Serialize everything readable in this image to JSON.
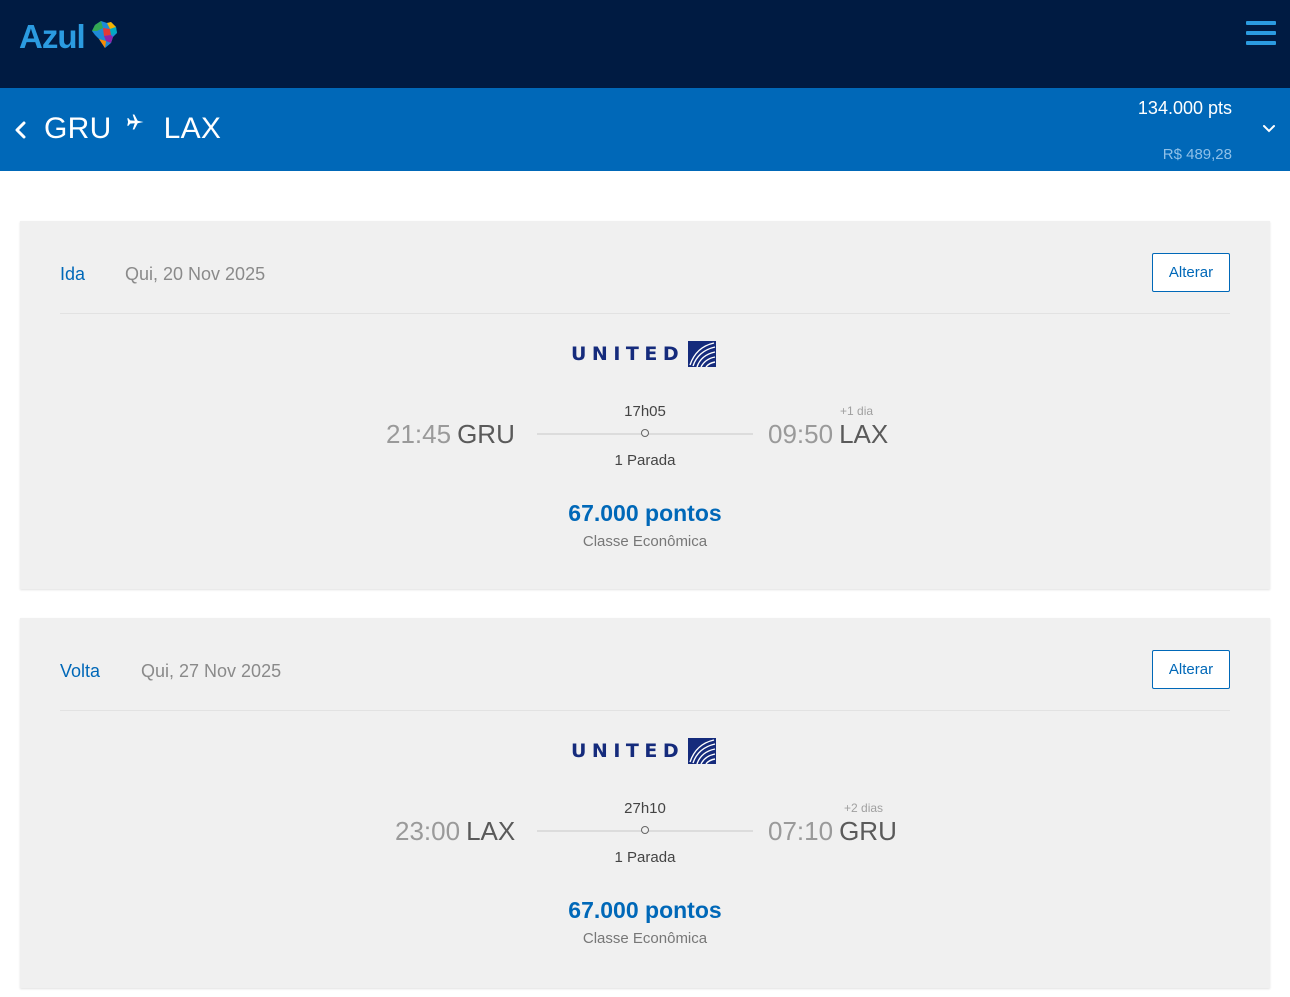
{
  "header": {
    "logo_text": "Azul",
    "brand_color": "#2b9be0",
    "menu_icon": "hamburger-icon"
  },
  "route_bar": {
    "origin": "GRU",
    "destination": "LAX",
    "points_total": "134.000 pts",
    "price_brl": "R$ 489,28",
    "background": "#0068b8"
  },
  "legs": [
    {
      "label": "Ida",
      "date": "Qui, 20 Nov 2025",
      "change_label": "Alterar",
      "airline": "UNITED",
      "depart_time": "21:45",
      "depart_code": "GRU",
      "arrive_time": "09:50",
      "arrive_code": "LAX",
      "day_shift": "+1 dia",
      "duration": "17h05",
      "stops": "1 Parada",
      "points": "67.000 pontos",
      "cabin": "Classe Econômica"
    },
    {
      "label": "Volta",
      "date": "Qui, 27 Nov 2025",
      "change_label": "Alterar",
      "airline": "UNITED",
      "depart_time": "23:00",
      "depart_code": "LAX",
      "arrive_time": "07:10",
      "arrive_code": "GRU",
      "day_shift": "+2 dias",
      "duration": "27h10",
      "stops": "1 Parada",
      "points": "67.000 pontos",
      "cabin": "Classe Econômica"
    }
  ]
}
